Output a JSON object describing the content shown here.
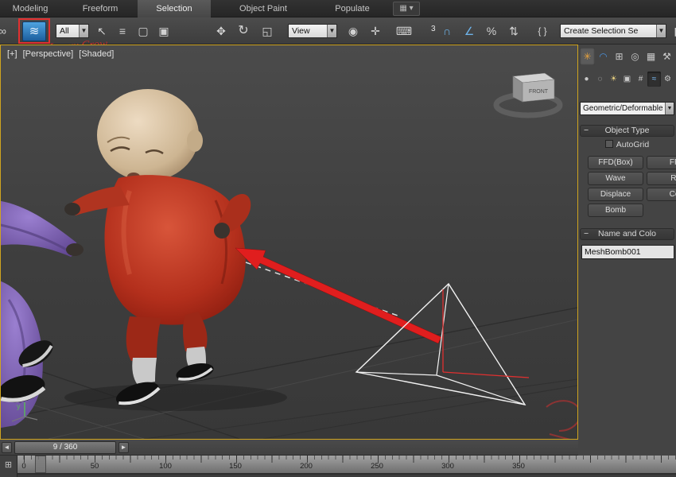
{
  "ribbon": {
    "tabs": [
      {
        "label": "Modeling"
      },
      {
        "label": "Freeform"
      },
      {
        "label": "Selection"
      },
      {
        "label": "Object Paint"
      },
      {
        "label": "Populate"
      }
    ],
    "active_tab": "Selection",
    "overflow_glyph": "▦ ▾"
  },
  "toolbar": {
    "watermark": "Lapxx Crow",
    "filter_combo_value": "All",
    "coord_combo_value": "View",
    "selection_set_combo_value": "Create Selection Se",
    "snap_count": "3",
    "icons": [
      {
        "name": "select-and-link-icon",
        "glyph": "∞"
      },
      {
        "name": "bind-to-space-warp-icon",
        "glyph": "≋"
      },
      {
        "name": "select-object-icon",
        "glyph": "↖"
      },
      {
        "name": "select-by-name-icon",
        "glyph": "≡"
      },
      {
        "name": "rectangular-selection-region-icon",
        "glyph": "▢"
      },
      {
        "name": "window-crossing-icon",
        "glyph": "▣"
      },
      {
        "name": "select-and-move-icon",
        "glyph": "✥"
      },
      {
        "name": "select-and-rotate-icon",
        "glyph": "↻"
      },
      {
        "name": "select-and-scale-icon",
        "glyph": "◱"
      },
      {
        "name": "use-pivot-point-center-icon",
        "glyph": "◉"
      },
      {
        "name": "select-and-manipulate-icon",
        "glyph": "✛"
      },
      {
        "name": "keyboard-override-icon",
        "glyph": "⌨"
      },
      {
        "name": "snap-toggle-icon",
        "glyph": "∩"
      },
      {
        "name": "angle-snap-icon",
        "glyph": "∠"
      },
      {
        "name": "percent-snap-icon",
        "glyph": "%"
      },
      {
        "name": "spinner-snap-icon",
        "glyph": "⇅"
      },
      {
        "name": "named-selection-sets-icon",
        "glyph": "{ }"
      },
      {
        "name": "mirror-icon",
        "glyph": "◧"
      }
    ],
    "combo_arrow": "▼"
  },
  "viewport": {
    "menus": [
      "[+]",
      "[Perspective]",
      "[Shaded]"
    ],
    "viewcube_label": "FRONT",
    "axis_label": "y"
  },
  "command_panel": {
    "tabs": [
      {
        "name": "create",
        "glyph": "✳"
      },
      {
        "name": "modify",
        "glyph": "◠"
      },
      {
        "name": "hierarchy",
        "glyph": "⊞"
      },
      {
        "name": "motion",
        "glyph": "◎"
      },
      {
        "name": "display",
        "glyph": "▦"
      },
      {
        "name": "utilities",
        "glyph": "⚒"
      }
    ],
    "categories": [
      {
        "name": "geometry",
        "glyph": "●"
      },
      {
        "name": "shapes",
        "glyph": "◌"
      },
      {
        "name": "lights",
        "glyph": "☀"
      },
      {
        "name": "cameras",
        "glyph": "▣"
      },
      {
        "name": "helpers",
        "glyph": "#"
      },
      {
        "name": "space-warps",
        "glyph": "≈"
      },
      {
        "name": "systems",
        "glyph": "⚙"
      }
    ],
    "subcategory_value": "Geometric/Deformable",
    "object_type_title": "Object Type",
    "autogrid_label": "AutoGrid",
    "buttons": [
      "FFD(Box)",
      "FF",
      "Wave",
      "Ri",
      "Displace",
      "Co",
      "Bomb"
    ],
    "name_rollout_title": "Name and Colo",
    "object_name": "MeshBomb001",
    "rollout_minus": "−"
  },
  "timeline": {
    "frame_display": "9 / 360",
    "arrow_left": "◄",
    "arrow_right": "►",
    "ticks": [
      "0",
      "50",
      "100",
      "150",
      "200",
      "250",
      "300",
      "350"
    ],
    "mini_curve_glyph": "⊞"
  },
  "colors": {
    "viewport_border": "#cfa41f",
    "annotation_red": "#e23030",
    "space_warp_blue": "#1c5e9e"
  }
}
